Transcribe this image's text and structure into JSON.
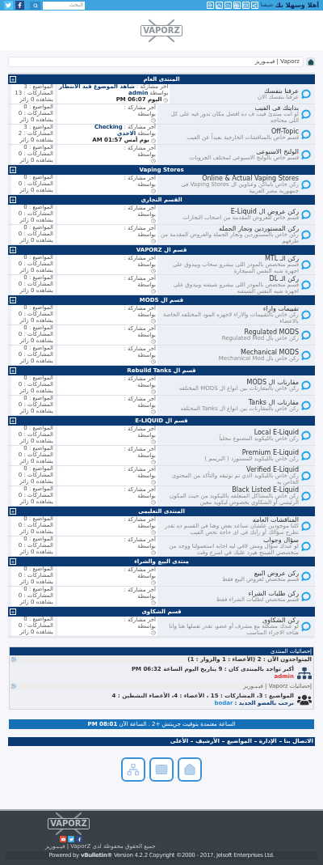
{
  "topbar": {
    "greeting": "أهلا وسهلا بك",
    "guest": "ضيفنا",
    "search_placeholder": "البحث"
  },
  "logo": "VAPORZ",
  "breadcrumb": "Vaporz | فيـبـوريز",
  "sections": [
    {
      "title": "المنتدى العام",
      "forums": [
        {
          "title": "عرفنا بنفسك",
          "description": "عرفنا بنفسك الان",
          "last_post": {
            "label": "آخر مشاركة :",
            "topic": "شاهد الموضوع قيد الانتظار",
            "by": "بواسطة",
            "user": "admin",
            "time": "اليوم PM 06:07"
          },
          "stats": [
            "المواضيع : 3",
            "المشاركات : 13",
            "يشاهده 0 زائر"
          ]
        },
        {
          "title": "بدايتك فى الفيب",
          "description": "لو انت مبتدئ فيب ف ده افضل مكان تدور فيه على كل اللى محتاجه",
          "last_post": {
            "label": "آخر مشاركة :",
            "by": "بواسطة"
          },
          "stats": [
            "المواضيع : 0",
            "المشاركات : 0",
            "يشاهده 0 زائر"
          ]
        },
        {
          "title": "Off-Topic",
          "description": "قسم خاص بالمناقشات الخارجية بعيداً عن الفيب",
          "last_post": {
            "label": "آخر مشاركة :",
            "topic": "Checking",
            "by": "بواسطة",
            "user": "الاحدي",
            "time": "يوم أمس AM 01:57"
          },
          "stats": [
            "المواضيع : 3",
            "المشاركات : 2",
            "يشاهده 0 زائر"
          ]
        },
        {
          "title": "الولنج الاسبوعى",
          "description": "قسم خاص بالولنج الاسبوعى لمختلف الجروبات",
          "last_post": {
            "label": "آخر مشاركة :",
            "by": "بواسطة"
          },
          "stats": [
            "المواضيع : 0",
            "المشاركات : 0",
            "يشاهده 0 زائر"
          ]
        }
      ]
    },
    {
      "title": "Vaping Stores",
      "forums": [
        {
          "title": "Online & Actual Vaping Stores",
          "description": "ركن خاص باماكن وعناوين ال Vaping Stores فى جمهورية مصر العربية",
          "last_post": {
            "label": "آخر مشاركة :",
            "by": "بواسطة"
          },
          "stats": [
            "المواضيع : 0",
            "المشاركات : 0",
            "يشاهده 0 زائر"
          ]
        }
      ]
    },
    {
      "title": "القسم التجاري",
      "forums": [
        {
          "title": "ركن عروض ال E-Liquid",
          "description": "قسم خاص للعروض المقدمة من اصحاب التجارات",
          "last_post": {
            "label": "آخر مشاركة :",
            "by": "بواسطة"
          },
          "stats": [
            "المواضيع : 0",
            "المشاركات : 0",
            "يشاهده 0 زائر"
          ]
        },
        {
          "title": "ركن المستوردين وتجار الجمله",
          "description": "ركن خاص بالمستوردين وتجار الجملة والعروض المقدمة من طرفهم",
          "last_post": {
            "label": "آخر مشاركة :",
            "by": "بواسطة"
          },
          "stats": [
            "المواضيع : 0",
            "المشاركات : 0",
            "يشاهده 0 زائر"
          ]
        }
      ]
    },
    {
      "title": "قسم ال VAPORZ",
      "forums": [
        {
          "title": "ركن الـ MTL",
          "description": "قسم متخصص بالمودز اللى بيشرو سحاب وبيدوق على اجهزة شبه النفس السيجارة",
          "last_post": {
            "label": "آخر مشاركة :",
            "by": "بواسطة"
          },
          "stats": [
            "المواضيع : 0",
            "المشاركات : 0",
            "يشاهده 0 زائر"
          ]
        },
        {
          "title": "ركن الـ DL",
          "description": "قسم متخصص بالمودز اللى بيشرو شيشه وبيدوق على اجهزة شبه النفس الشيشه",
          "last_post": {
            "label": "آخر مشاركة :",
            "by": "بواسطة"
          },
          "stats": [
            "المواضيع : 0",
            "المشاركات : 0",
            "يشاهده 0 زائر"
          ]
        }
      ]
    },
    {
      "title": "قسم ال MODS",
      "forums": [
        {
          "title": "تقييمات واراء",
          "description": "ركن خاص بالتقييمات والاراء لاجهزه المود المختلفه الخاصة بالاعضاء",
          "last_post": {
            "label": "آخر مشاركة :",
            "by": "بواسطة"
          },
          "stats": [
            "المواضيع : 0",
            "المشاركات : 0",
            "يشاهده 0 زائر"
          ]
        },
        {
          "title": "Regulated MODS",
          "description": "ركن خاص بال Regulated Mod",
          "last_post": {
            "label": "آخر مشاركة :",
            "by": "بواسطة"
          },
          "stats": [
            "المواضيع : 0",
            "المشاركات : 0",
            "يشاهده 0 زائر"
          ]
        },
        {
          "title": "Mechanical MODS",
          "description": "ركن خاص بال Mechanical Mod",
          "last_post": {
            "label": "آخر مشاركة :",
            "by": "بواسطة"
          },
          "stats": [
            "المواضيع : 0",
            "المشاركات : 0",
            "يشاهده 0 زائر"
          ]
        }
      ]
    },
    {
      "title": "قسم ال Rebuild Tanks",
      "forums": [
        {
          "title": "مقارنات ال MODS",
          "description": "ركن خاص بالمقارنات بين انواع ال MODS المختلفه",
          "last_post": {
            "label": "آخر مشاركة :",
            "by": "بواسطة"
          },
          "stats": [
            "المواضيع : 0",
            "المشاركات : 0",
            "يشاهده 0 زائر"
          ]
        },
        {
          "title": "مقارنات ال Tanks",
          "description": "ركن خاص بالمقارنات بين انواع ال Tanks المختلفه",
          "last_post": {
            "label": "آخر مشاركة :",
            "by": "بواسطة"
          },
          "stats": [
            "المواضيع : 0",
            "المشاركات : 0",
            "يشاهده 0 زائر"
          ]
        }
      ]
    },
    {
      "title": "قسم ال E-LIQUID",
      "forums": [
        {
          "title": "Local E-Liquid",
          "description": "ركن خاص بالليكويد المصنوع محلياً",
          "last_post": {
            "label": "آخر مشاركة :",
            "by": "بواسطة"
          },
          "stats": [
            "المواضيع : 0",
            "المشاركات : 0",
            "يشاهده 0 زائر"
          ]
        },
        {
          "title": "Premium E-Liquid",
          "description": "ركن خاص بالليكويد المستورد ( البريمم )",
          "last_post": {
            "label": "آخر مشاركة :",
            "by": "بواسطة"
          },
          "stats": [
            "المواضيع : 0",
            "المشاركات : 0",
            "يشاهده 0 زائر"
          ]
        },
        {
          "title": "Verified E-Liquid",
          "description": "ركن خاص بالليكويد الذي تم توثيقه والتأكد من المحتوى الخاص به",
          "last_post": {
            "label": "آخر مشاركة :",
            "by": "بواسطة"
          },
          "stats": [
            "المواضيع : 0",
            "المشاركات : 0",
            "يشاهده 0 زائر"
          ]
        },
        {
          "title": "Black Listed E-Liquid",
          "description": "ركن خاص بالمشاكل المتعلقه بالليكويد من حيث المكون الرئيسي أو الشكاوي بخصوص ليكويد معين",
          "last_post": {
            "label": "آخر مشاركة :",
            "by": "بواسطة"
          },
          "stats": [
            "المواضيع : 0",
            "المشاركات : 0",
            "يشاهده 0 زائر"
          ]
        }
      ]
    },
    {
      "title": "المنتدى التعليمى",
      "forums": [
        {
          "title": "المناقشات العامه",
          "description": "كلنا موجودين علشان نساعد بعض وهنا فى القسم ده تقدر تطرح سؤالك أو رأيك فى اى حاجة تخص الفيب",
          "last_post": {
            "label": "آخر مشاركة :",
            "by": "بواسطة"
          },
          "stats": [
            "المواضيع : 0",
            "المشاركات : 0",
            "يشاهده 0 زائر"
          ]
        },
        {
          "title": "سؤال وجواب",
          "description": "لو عندك سؤال ومش لاقي ليه اجابه استعمولنا ووجد من متخصصي الفيبنج هيرد عليك في اسرع وقت",
          "last_post": {
            "label": "آخر مشاركة :",
            "by": "بواسطة"
          },
          "stats": [
            "المواضيع : 0",
            "المشاركات : 0",
            "يشاهده 0 زائر"
          ]
        }
      ]
    },
    {
      "title": "منتدى البيع والشراء",
      "forums": [
        {
          "title": "ركن عروض البيع",
          "description": "قسم متخصص لعروض البيع فقط",
          "last_post": {
            "label": "آخر مشاركة :",
            "by": "بواسطة"
          },
          "stats": [
            "المواضيع : 0",
            "المشاركات : 0",
            "يشاهده 0 زائر"
          ]
        },
        {
          "title": "ركن طلبات الشراء",
          "description": "قسم متخصص لطلبات الشراء فقط",
          "last_post": {
            "label": "آخر مشاركة :",
            "by": "بواسطة"
          },
          "stats": [
            "المواضيع : 0",
            "المشاركات : 0",
            "يشاهده 0 زائر"
          ]
        }
      ]
    },
    {
      "title": "قسم الشكاوى",
      "forums": [
        {
          "title": "ركن الشكاوى",
          "description": "لو عندك مشكلة مع مشرف أو عضو، تقدر تعملها هنا وانا هناخد الاجراء المناسب",
          "last_post": {
            "label": "آخر مشاركة :",
            "by": "بواسطة"
          },
          "stats": [
            "المواضيع : 0",
            "المشاركات : 0",
            "يشاهده 0 زائر"
          ]
        }
      ]
    }
  ],
  "statistics": {
    "title": "إحصائيات المنتدى",
    "online": "المتواجدون الآن : 2 (الأعضاء : 1 والزوار : 1)",
    "record": "أكبر تواجد بالمنتدى كان : 9 بتاريخ اليوم الساعة PM 06:32",
    "record_user": "admin",
    "site_stats_title": "إحصائيات Vaporz | فيـبـوريز",
    "counts": "المواضيع : 3، المشاركات : 15 ، الأعضاء : 4، الأعضاء النشطين : 4",
    "newest_label": "نرحب بالعضو الجديد :",
    "newest_user": "bodar"
  },
  "time_bar": "الساعة معتمدة بتوقيت جرينتش +2 . الساعة الآن **PM 08:01**",
  "footer_links": [
    "الاتصال بنا",
    "الإدارة",
    "المواضيع",
    "الأرشيف",
    "الأعلى"
  ],
  "footer": {
    "logo": "VAPORZ",
    "rights": "جميع الحقوق محفوظة لدى VaporZ | فيـبـوريز",
    "powered": "Powered by **vBulletin®** Version 4.2.2 Copyright ©2000 - 2017, Jelsoft Enterprises Ltd."
  }
}
